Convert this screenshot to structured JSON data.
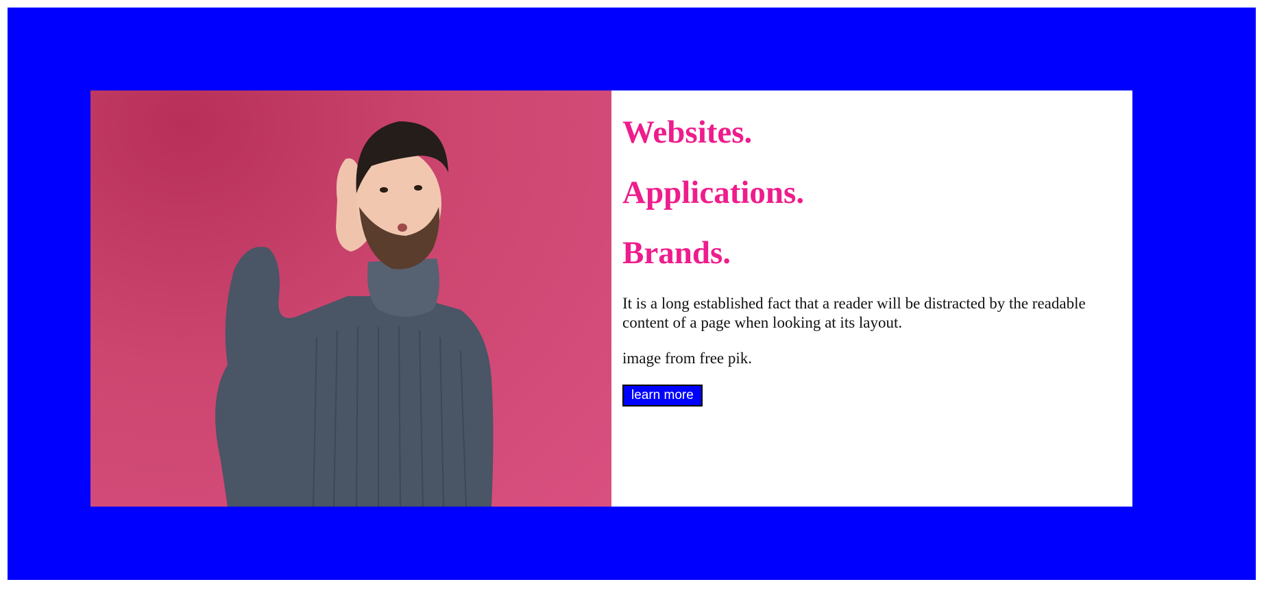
{
  "hero": {
    "headlines": [
      "Websites.",
      "Applications.",
      "Brands."
    ],
    "description": "It is a long established fact that a reader will be distracted by the readable content of a page when looking at its layout.",
    "credit": "image from free pik.",
    "button_label": "learn more"
  },
  "colors": {
    "frame": "#0000ff",
    "headline": "#ee1c8c",
    "photo_background": "#d04a78",
    "button_background": "#0000ff"
  }
}
